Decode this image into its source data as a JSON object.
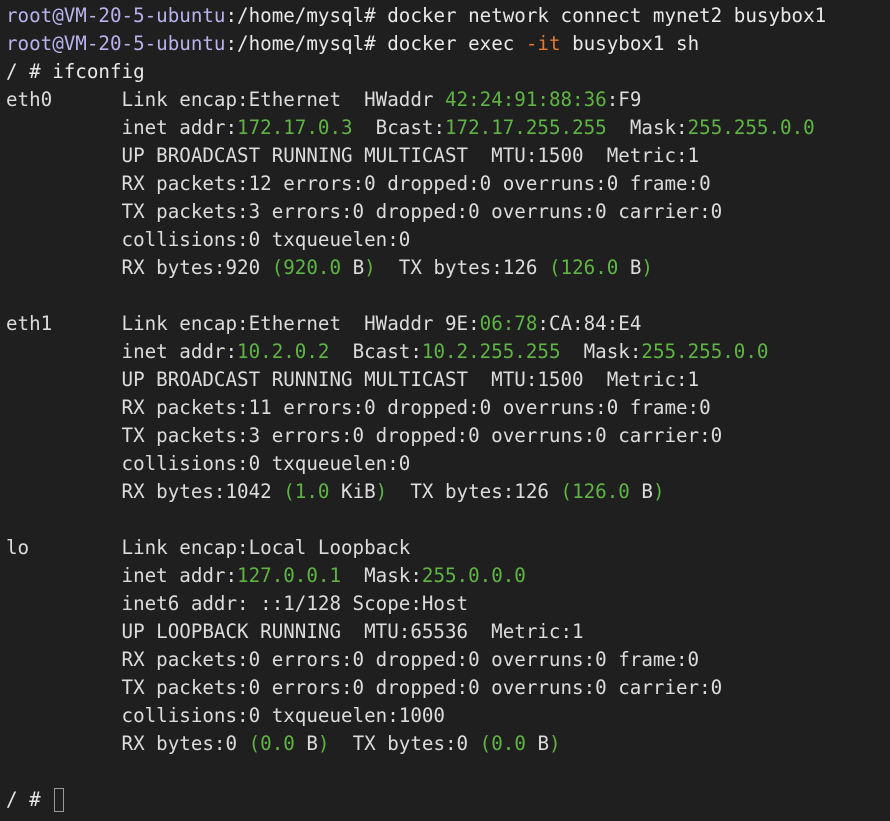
{
  "colors": {
    "background": "#1f1f1f",
    "text": "#dcdcdc",
    "prompt_user": "#b8b3ee",
    "flag": "#e07a2f",
    "green": "#5fb544"
  },
  "lines": [
    [
      {
        "t": "root@VM-20-5-ubuntu",
        "c": "prompt-user"
      },
      {
        "t": ":/home/mysql# ",
        "c": "prompt-path"
      },
      {
        "t": "docker network connect mynet2 busybox1",
        "c": "cmd"
      }
    ],
    [
      {
        "t": "root@VM-20-5-ubuntu",
        "c": "prompt-user"
      },
      {
        "t": ":/home/mysql# ",
        "c": "prompt-path"
      },
      {
        "t": "docker exec ",
        "c": "cmd"
      },
      {
        "t": "-it",
        "c": "flag"
      },
      {
        "t": " busybox1 sh",
        "c": "cmd"
      }
    ],
    [
      {
        "t": "/ # ifconfig",
        "c": "cmd"
      }
    ],
    [
      {
        "t": "eth0      Link encap:Ethernet  HWaddr ",
        "c": "normal"
      },
      {
        "t": "42:24:91:88:36",
        "c": "green"
      },
      {
        "t": ":F9",
        "c": "normal"
      }
    ],
    [
      {
        "t": "          inet addr:",
        "c": "normal"
      },
      {
        "t": "172.17.0.3",
        "c": "green"
      },
      {
        "t": "  Bcast:",
        "c": "normal"
      },
      {
        "t": "172.17.255.255",
        "c": "green"
      },
      {
        "t": "  Mask:",
        "c": "normal"
      },
      {
        "t": "255.255.0.0",
        "c": "green"
      }
    ],
    [
      {
        "t": "          UP BROADCAST RUNNING MULTICAST  MTU:1500  Metric:1",
        "c": "normal"
      }
    ],
    [
      {
        "t": "          RX packets:12 errors:0 dropped:0 overruns:0 frame:0",
        "c": "normal"
      }
    ],
    [
      {
        "t": "          TX packets:3 errors:0 dropped:0 overruns:0 carrier:0",
        "c": "normal"
      }
    ],
    [
      {
        "t": "          collisions:0 txqueuelen:0",
        "c": "normal"
      }
    ],
    [
      {
        "t": "          RX bytes:920 ",
        "c": "normal"
      },
      {
        "t": "(920.0 ",
        "c": "green"
      },
      {
        "t": "B",
        "c": "normal"
      },
      {
        "t": ")",
        "c": "green"
      },
      {
        "t": "  TX bytes:126 ",
        "c": "normal"
      },
      {
        "t": "(126.0 ",
        "c": "green"
      },
      {
        "t": "B",
        "c": "normal"
      },
      {
        "t": ")",
        "c": "green"
      }
    ],
    [],
    [
      {
        "t": "eth1      Link encap:Ethernet  HWaddr 9E:",
        "c": "normal"
      },
      {
        "t": "06:78",
        "c": "green"
      },
      {
        "t": ":CA:84:E4",
        "c": "normal"
      }
    ],
    [
      {
        "t": "          inet addr:",
        "c": "normal"
      },
      {
        "t": "10.2.0.2",
        "c": "green"
      },
      {
        "t": "  Bcast:",
        "c": "normal"
      },
      {
        "t": "10.2.255.255",
        "c": "green"
      },
      {
        "t": "  Mask:",
        "c": "normal"
      },
      {
        "t": "255.255.0.0",
        "c": "green"
      }
    ],
    [
      {
        "t": "          UP BROADCAST RUNNING MULTICAST  MTU:1500  Metric:1",
        "c": "normal"
      }
    ],
    [
      {
        "t": "          RX packets:11 errors:0 dropped:0 overruns:0 frame:0",
        "c": "normal"
      }
    ],
    [
      {
        "t": "          TX packets:3 errors:0 dropped:0 overruns:0 carrier:0",
        "c": "normal"
      }
    ],
    [
      {
        "t": "          collisions:0 txqueuelen:0",
        "c": "normal"
      }
    ],
    [
      {
        "t": "          RX bytes:1042 ",
        "c": "normal"
      },
      {
        "t": "(1.0 ",
        "c": "green"
      },
      {
        "t": "KiB",
        "c": "normal"
      },
      {
        "t": ")",
        "c": "green"
      },
      {
        "t": "  TX bytes:126 ",
        "c": "normal"
      },
      {
        "t": "(126.0 ",
        "c": "green"
      },
      {
        "t": "B",
        "c": "normal"
      },
      {
        "t": ")",
        "c": "green"
      }
    ],
    [],
    [
      {
        "t": "lo        Link encap:Local Loopback",
        "c": "normal"
      }
    ],
    [
      {
        "t": "          inet addr:",
        "c": "normal"
      },
      {
        "t": "127.0.0.1",
        "c": "green"
      },
      {
        "t": "  Mask:",
        "c": "normal"
      },
      {
        "t": "255.0.0.0",
        "c": "green"
      }
    ],
    [
      {
        "t": "          inet6 addr: ::1/128 Scope:Host",
        "c": "normal"
      }
    ],
    [
      {
        "t": "          UP LOOPBACK RUNNING  MTU:65536  Metric:1",
        "c": "normal"
      }
    ],
    [
      {
        "t": "          RX packets:0 errors:0 dropped:0 overruns:0 frame:0",
        "c": "normal"
      }
    ],
    [
      {
        "t": "          TX packets:0 errors:0 dropped:0 overruns:0 carrier:0",
        "c": "normal"
      }
    ],
    [
      {
        "t": "          collisions:0 txqueuelen:1000",
        "c": "normal"
      }
    ],
    [
      {
        "t": "          RX bytes:0 ",
        "c": "normal"
      },
      {
        "t": "(0.0 ",
        "c": "green"
      },
      {
        "t": "B",
        "c": "normal"
      },
      {
        "t": ")",
        "c": "green"
      },
      {
        "t": "  TX bytes:0 ",
        "c": "normal"
      },
      {
        "t": "(0.0 ",
        "c": "green"
      },
      {
        "t": "B",
        "c": "normal"
      },
      {
        "t": ")",
        "c": "green"
      }
    ],
    [],
    [
      {
        "t": "/ # ",
        "c": "cmd"
      }
    ]
  ],
  "cursor_icon": "block-cursor-icon"
}
